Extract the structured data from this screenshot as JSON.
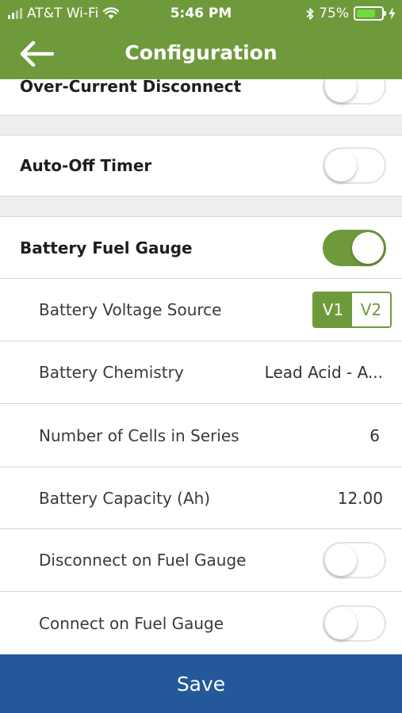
{
  "status_bar": {
    "carrier": "AT&T Wi-Fi",
    "time": "5:46 PM",
    "battery_percent": "75%",
    "battery_level": 0.75
  },
  "header": {
    "title": "Configuration"
  },
  "settings": {
    "over_current_disconnect": {
      "label": "Over-Current Disconnect",
      "enabled": false
    },
    "auto_off_timer": {
      "label": "Auto-Off Timer",
      "enabled": false
    },
    "battery_fuel_gauge": {
      "label": "Battery Fuel Gauge",
      "enabled": true
    },
    "battery_voltage_source": {
      "label": "Battery Voltage Source",
      "options": [
        "V1",
        "V2"
      ],
      "selected": "V1"
    },
    "battery_chemistry": {
      "label": "Battery Chemistry",
      "value": "Lead Acid - A..."
    },
    "number_of_cells": {
      "label": "Number of Cells in Series",
      "value": "6"
    },
    "battery_capacity": {
      "label": "Battery Capacity (Ah)",
      "value": "12.00"
    },
    "disconnect_on_fuel_gauge": {
      "label": "Disconnect on Fuel Gauge",
      "enabled": false
    },
    "connect_on_fuel_gauge": {
      "label": "Connect on Fuel Gauge",
      "enabled": false
    }
  },
  "footer": {
    "save_label": "Save"
  },
  "colors": {
    "brand_green": "#6f9a3c",
    "save_blue": "#23589b",
    "separator_gray": "#efefef"
  },
  "icons": {
    "back": "arrow-left-icon",
    "wifi": "wifi-icon",
    "bluetooth": "bluetooth-icon",
    "charging": "charging-bolt-icon"
  }
}
